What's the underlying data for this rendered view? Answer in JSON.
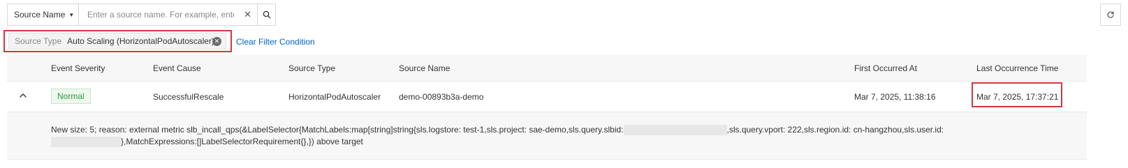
{
  "search": {
    "field_label": "Source Name",
    "placeholder": "Enter a source name. For example, enter an",
    "value": "",
    "clear_glyph": "✕"
  },
  "filter": {
    "key": "Source Type",
    "value": "Auto Scaling (HorizontalPodAutoscaler)",
    "close_glyph": "✕",
    "clear_label": "Clear Filter Condition"
  },
  "icons": {
    "search": "search-icon",
    "refresh": "refresh-icon",
    "collapse": "chevron-up-icon",
    "dropdown": "caret-down-icon",
    "caret_glyph": "▼"
  },
  "table": {
    "headers": {
      "severity": "Event Severity",
      "cause": "Event Cause",
      "source_type": "Source Type",
      "source_name": "Source Name",
      "first_occurred": "First Occurred At",
      "last_occurred": "Last Occurrence Time"
    },
    "row": {
      "severity": "Normal",
      "cause": "SuccessfulRescale",
      "source_type": "HorizontalPodAutoscaler",
      "source_name": "demo-00893b3a-demo",
      "first_occurred": "Mar 7, 2025, 11:38:16",
      "last_occurred": "Mar 7, 2025, 17:37:21"
    },
    "detail": {
      "part1": "New size: 5; reason: external metric slb_incall_qps(&LabelSelector{MatchLabels:map[string]string{sls.logstore: test-1,sls.project: sae-demo,sls.query.slbid:",
      "part2": ",sls.query.vport: 222,sls.region.id: cn-hangzhou,sls.user.id:",
      "part3": "},MatchExpressions:[]LabelSelectorRequirement{},}) above target"
    }
  },
  "colors": {
    "highlight_border": "#d0393e",
    "link": "#0064c8",
    "badge_green": "#2a9d3b"
  }
}
